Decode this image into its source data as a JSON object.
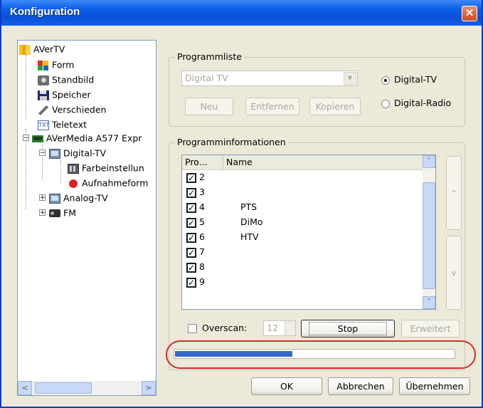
{
  "window": {
    "title": "Konfiguration",
    "close_glyph": "✕"
  },
  "tree": {
    "items": [
      {
        "label": "AVerTV",
        "icon": "avertv-icon"
      },
      {
        "label": "Form",
        "icon": "form-icon"
      },
      {
        "label": "Standbild",
        "icon": "camera-icon"
      },
      {
        "label": "Speicher",
        "icon": "floppy-disk-icon"
      },
      {
        "label": "Verschieden",
        "icon": "wrench-icon"
      },
      {
        "label": "Teletext",
        "icon": "teletext-icon"
      },
      {
        "label": "AVerMedia A577 Expr",
        "icon": "tv-card-icon"
      },
      {
        "label": "Digital-TV",
        "icon": "monitor-icon"
      },
      {
        "label": "Farbeinstellun",
        "icon": "color-settings-icon"
      },
      {
        "label": "Aufnahmeform",
        "icon": "record-icon"
      },
      {
        "label": "Analog-TV",
        "icon": "monitor-icon"
      },
      {
        "label": "FM",
        "icon": "radio-icon"
      }
    ],
    "expand_minus": "−",
    "expand_plus": "+",
    "scroll_left": "<",
    "scroll_right": ">"
  },
  "programmliste": {
    "legend": "Programmliste",
    "combo_value": "Digital TV",
    "buttons": {
      "neu": "Neu",
      "entfernen": "Entfernen",
      "kopieren": "Kopieren"
    },
    "radio_tv": "Digital-TV",
    "radio_radio": "Digital-Radio",
    "selected": "Digital-TV"
  },
  "programminfo": {
    "legend": "Programminformationen",
    "columns": {
      "pro": "Pro...",
      "name": "Name"
    },
    "rows": [
      {
        "num": "2",
        "name": ""
      },
      {
        "num": "3",
        "name": ""
      },
      {
        "num": "4",
        "name": "PTS"
      },
      {
        "num": "5",
        "name": "DiMo"
      },
      {
        "num": "6",
        "name": "HTV"
      },
      {
        "num": "7",
        "name": ""
      },
      {
        "num": "8",
        "name": ""
      },
      {
        "num": "9",
        "name": ""
      }
    ],
    "check_glyph": "✓",
    "scroll_up": "˄",
    "scroll_down": "˅",
    "side_up": "^",
    "side_down": "v",
    "overscan_label": "Overscan:",
    "overscan_value": "12",
    "stop_label": "Stop",
    "erweitert_label": "Erweitert",
    "progress_fraction": 0.42
  },
  "footer": {
    "ok": "OK",
    "abbrechen": "Abbrechen",
    "uebernehmen": "Übernehmen"
  },
  "colors": {
    "title_blue": "#0b5ee8",
    "progress": "#3669c9",
    "highlight": "#d03030"
  }
}
